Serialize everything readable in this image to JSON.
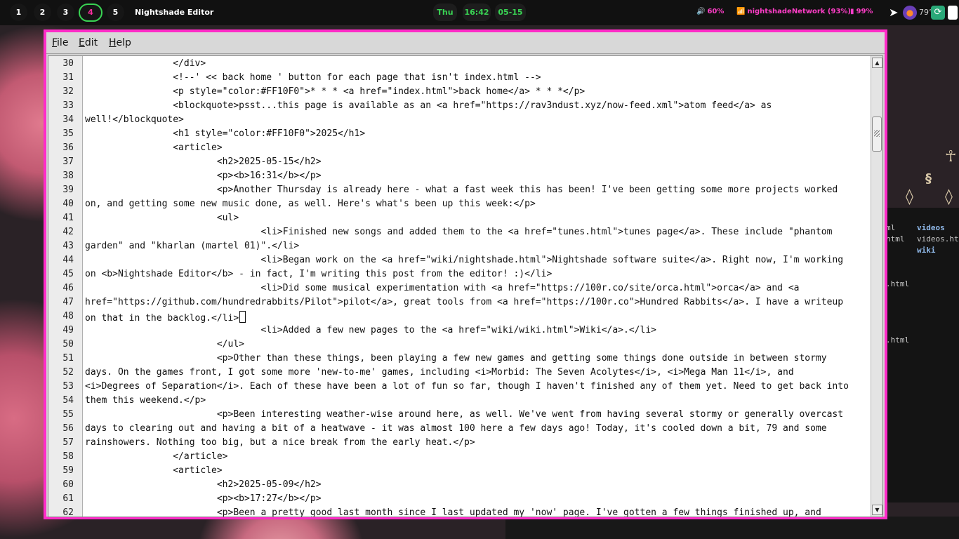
{
  "topbar": {
    "workspaces": [
      "1",
      "2",
      "3",
      "4",
      "5"
    ],
    "active_workspace": "4",
    "window_title": "Nightshade Editor",
    "day": "Thu",
    "time": "16:42",
    "date": "05-15",
    "volume": "60%",
    "network": "nightshadeNetwork (93%)",
    "battery": "99%",
    "temperature": "79°",
    "accent_color": "#ff2cc8",
    "clock_color": "#39d353"
  },
  "menu": {
    "file": "File",
    "edit": "Edit",
    "help": "Help"
  },
  "background_terminal": {
    "items": [
      "ml",
      "videos",
      "html",
      "videos.ht",
      "wiki",
      ".html",
      ".html"
    ]
  },
  "editor": {
    "line_numbers": [
      "30",
      "31",
      "32",
      "33",
      "34",
      "35",
      "36",
      "37",
      "38",
      "39",
      "40",
      "41",
      "42",
      "43",
      "44",
      "45",
      "46",
      "47",
      "48",
      "49",
      "50",
      "51",
      "52",
      "53",
      "54",
      "55",
      "56",
      "57",
      "58",
      "59",
      "60",
      "61",
      "62"
    ],
    "lines": [
      "                </div>",
      "                <!--' << back home ' button for each page that isn't index.html -->",
      "                <p style=\"color:#FF10F0\">* * * <a href=\"index.html\">back home</a> * * *</p>",
      "                <blockquote>psst...this page is available as an <a href=\"https://rav3ndust.xyz/now-feed.xml\">atom feed</a> as",
      "well!</blockquote>",
      "                <h1 style=\"color:#FF10F0\">2025</h1>",
      "                <article>",
      "                        <h2>2025-05-15</h2>",
      "                        <p><b>16:31</b></p>",
      "                        <p>Another Thursday is already here - what a fast week this has been! I've been getting some more projects worked",
      "on, and getting some new music done, as well. Here's what's been up this week:</p>",
      "                        <ul>",
      "                                <li>Finished new songs and added them to the <a href=\"tunes.html\">tunes page</a>. These include \"phantom",
      "garden\" and \"kharlan (martel 01)\".</li>",
      "                                <li>Began work on the <a href=\"wiki/nightshade.html\">Nightshade software suite</a>. Right now, I'm working",
      "on <b>Nightshade Editor</b> - in fact, I'm writing this post from the editor! :)</li>",
      "                                <li>Did some musical experimentation with <a href=\"https://100r.co/site/orca.html\">orca</a> and <a",
      "href=\"https://github.com/hundredrabbits/Pilot\">pilot</a>, great tools from <a href=\"https://100r.co\">Hundred Rabbits</a>. I have a writeup",
      "on that in the backlog.</li>",
      "                                <li>Added a few new pages to the <a href=\"wiki/wiki.html\">Wiki</a>.</li>",
      "                        </ul>",
      "                        <p>Other than these things, been playing a few new games and getting some things done outside in between stormy",
      "days. On the games front, I got some more 'new-to-me' games, including <i>Morbid: The Seven Acolytes</i>, <i>Mega Man 11</i>, and",
      "<i>Degrees of Separation</i>. Each of these have been a lot of fun so far, though I haven't finished any of them yet. Need to get back into",
      "them this weekend.</p>",
      "                        <p>Been interesting weather-wise around here, as well. We've went from having several stormy or generally overcast",
      "days to clearing out and having a bit of a heatwave - it was almost 100 here a few days ago! Today, it's cooled down a bit, 79 and some",
      "rainshowers. Nothing too big, but a nice break from the early heat.</p>",
      "                </article>",
      "                <article>",
      "                        <h2>2025-05-09</h2>",
      "                        <p><b>17:27</b></p>",
      "                        <p>Been a pretty good last month since I last updated my 'now' page. I've gotten a few things finished up, and"
    ],
    "caret_line_index": 18
  },
  "scrollbar": {
    "up_arrow": "▲",
    "down_arrow": "▼"
  }
}
